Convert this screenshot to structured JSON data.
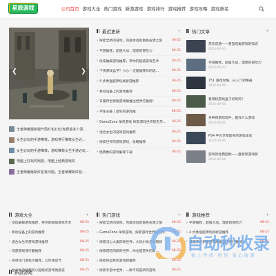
{
  "header": {
    "logo_text": "星辰游戏",
    "nav": [
      "公司首页",
      "游戏大全",
      "热门游戏",
      "新游游戏",
      "游戏排行",
      "游戏推荐",
      "游戏攻略",
      "游戏新名"
    ]
  },
  "featured": [
    "王者荣耀最新版开局红包10亿免费最多少领...",
    "女生必玩的手游推荐，游戏排行推荐女生必...",
    "女生必玩的手游推荐，游戏推荐女生手游必玩...",
    "电脑上好玩的网游，电脑上经典游戏的",
    "王者荣耀最新红包有问题，王者荣耀新红包..."
  ],
  "latest": {
    "title": "最近更新",
    "more": "+",
    "items": [
      {
        "text": "探索全新的游戏，完美体验的角色扮演之旅",
        "date": "08-25"
      },
      {
        "text": "手游推荐，超值大战，理想的冒险力",
        "date": "08-25"
      },
      {
        "text": "炫炫破解游戏推荐，带你的超级游戏艺术",
        "date": "08-25"
      },
      {
        "text": "下快游戏盒子？小心！这是推荐你的选...",
        "date": "08-25"
      },
      {
        "text": "4 步秀逸超神玩具新游推荐",
        "date": "08-25"
      },
      {
        "text": "移动设备上的游戏推荐",
        "date": "08-25"
      },
      {
        "text": "日服传世新版游戏版推出世界打雅榜！",
        "date": "08-25"
      },
      {
        "text": "学生必备 | 适生的游戏推",
        "date": "08-25"
      },
      {
        "text": "GameZone 单机游戏 探索游戏世界的无尽...",
        "date": "08-25"
      },
      {
        "text": "适合女生的游戏游戏推荐",
        "date": "08-25"
      },
      {
        "text": "探索世界的游戏游戏，攻略推荐",
        "date": "08-25"
      },
      {
        "text": "经典数码游戏解除下载",
        "date": "08-25"
      }
    ]
  },
  "hot": {
    "title": "热门文章",
    "more": "+",
    "items": [
      {
        "title": "苏东成语——重塑成角游戏的知识",
        "date": "2024-09-10"
      },
      {
        "title": "手游推荐，超值大战，理想的冒险力",
        "date": "2024-09-10"
      },
      {
        "title": "751 游戏攻略，从入门到精通",
        "date": "2024-09-08"
      },
      {
        "title": "看得机游戏盒子好玩吗？",
        "date": "2024-09-08"
      },
      {
        "title": "多种和游戏软件，是找什么游戏",
        "date": "2024-09-06"
      },
      {
        "title": "PS4 平台享受超多的游戏体验",
        "date": "2024-09-06"
      },
      {
        "title": "游戏的经典回顾——盘客新游戏新",
        "date": "2024-09-04"
      }
    ]
  },
  "bottom_panels": [
    {
      "title": "游戏大全",
      "more": "+",
      "items": [
        {
          "text": "炫炫破解游戏推荐，带你的超级游戏艺术",
          "date": "08-25"
        },
        {
          "text": "移动设备上的游戏推荐",
          "date": "08-25"
        },
        {
          "text": "适合女生的游戏游戏推荐",
          "date": "08-25"
        },
        {
          "text": "闯游游戏排行最推荐",
          "date": "08-25"
        },
        {
          "text": "多项热门游戏大推荐，让你体验节",
          "date": "08-25"
        },
        {
          "text": "盒式件游经典同小超级机游戏情感说",
          "date": "08-25"
        }
      ]
    },
    {
      "title": "热门游戏",
      "more": "+",
      "items": [
        {
          "text": "探索全新的游戏，完美体验的角色扮演之旅",
          "date": "08-25"
        },
        {
          "text": "GameZone 单机游戏，探索游戏世界的无尽...",
          "date": "08-25"
        },
        {
          "text": "探索决心大奥的新世界，大玩尔攻击体刚新",
          "date": "08-25"
        },
        {
          "text": "探索冒险的新的世界，你也是冒失的新...",
          "date": "08-25"
        },
        {
          "text": "探索好运移机游戏新推荐",
          "date": "08-25"
        },
        {
          "text": "探索手游中世界，一款不同前所的游戏",
          "date": "08-25"
        }
      ]
    },
    {
      "title": "游戏推荐",
      "more": "+",
      "items": [
        {
          "text": "手游推荐，超值大战，理想的冒险力",
          "date": "08-25"
        },
        {
          "text": "4 步秀逸超神玩具新游推荐",
          "date": "08-25"
        },
        {
          "text": "日服传世新版游戏版推出世界打雅榜！",
          "date": "08-25"
        }
      ]
    }
  ],
  "new_games": {
    "title": "新游游戏"
  },
  "watermark": {
    "title": "自动秒收录",
    "subtitle": "数 上 传 择 · 秒 到 · 省 心 收 录"
  }
}
